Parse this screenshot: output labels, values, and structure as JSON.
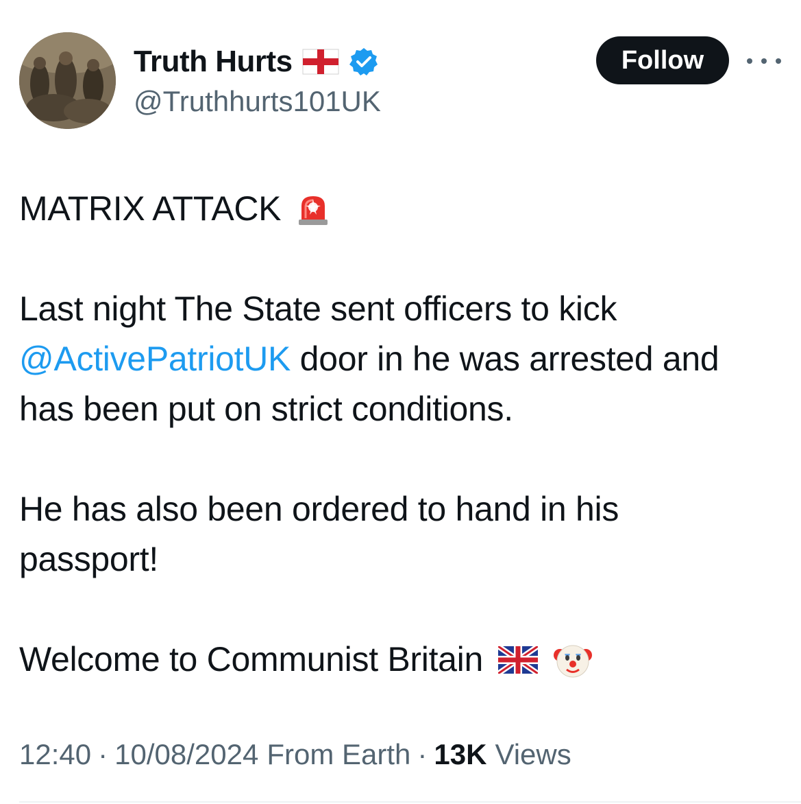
{
  "author": {
    "display_name": "Truth Hurts",
    "handle": "@Truthhurts101UK",
    "flag_icon": "england-flag-icon",
    "verified_icon": "verified-badge-icon",
    "verified_color": "#1d9bf0"
  },
  "actions": {
    "follow_label": "Follow",
    "more_icon": "more-options-icon"
  },
  "tweet": {
    "line1": "MATRIX ATTACK",
    "line1_emoji": "police-siren-emoji",
    "line2": "Last night The State sent officers to kick",
    "mention": "@ActivePatriotUK",
    "line3_rest": " door in he was arrested and",
    "line4": "has been put on strict conditions.",
    "line5": "He has also been ordered to hand in his",
    "line6": "passport!",
    "line7": "Welcome to Communist Britain",
    "line7_emojis": [
      "uk-flag-emoji",
      "clown-face-emoji"
    ],
    "mention_color": "#1d9bf0"
  },
  "meta": {
    "time": "12:40",
    "date": "10/08/2024",
    "source": "From Earth",
    "views_count": "13K",
    "views_label": "Views",
    "separator": "·"
  }
}
